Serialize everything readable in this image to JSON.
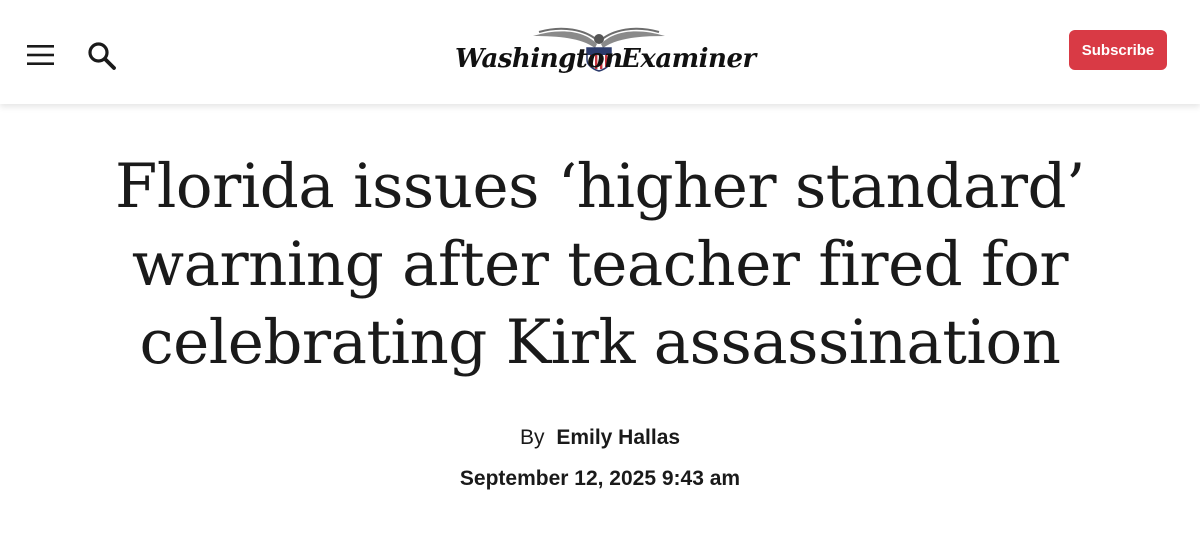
{
  "header": {
    "logo": {
      "left_word": "Washington",
      "right_word": "Examiner"
    },
    "subscribe_label": "Subscribe",
    "menu_icon": "hamburger-menu-icon",
    "search_icon": "search-icon",
    "accent_color": "#d93a45"
  },
  "article": {
    "headline": "Florida issues ‘higher standard’ warning after teacher fired for celebrating Kirk assassination",
    "byline_prefix": "By",
    "author": "Emily Hallas",
    "date": "September 12, 2025 9:43 am"
  }
}
